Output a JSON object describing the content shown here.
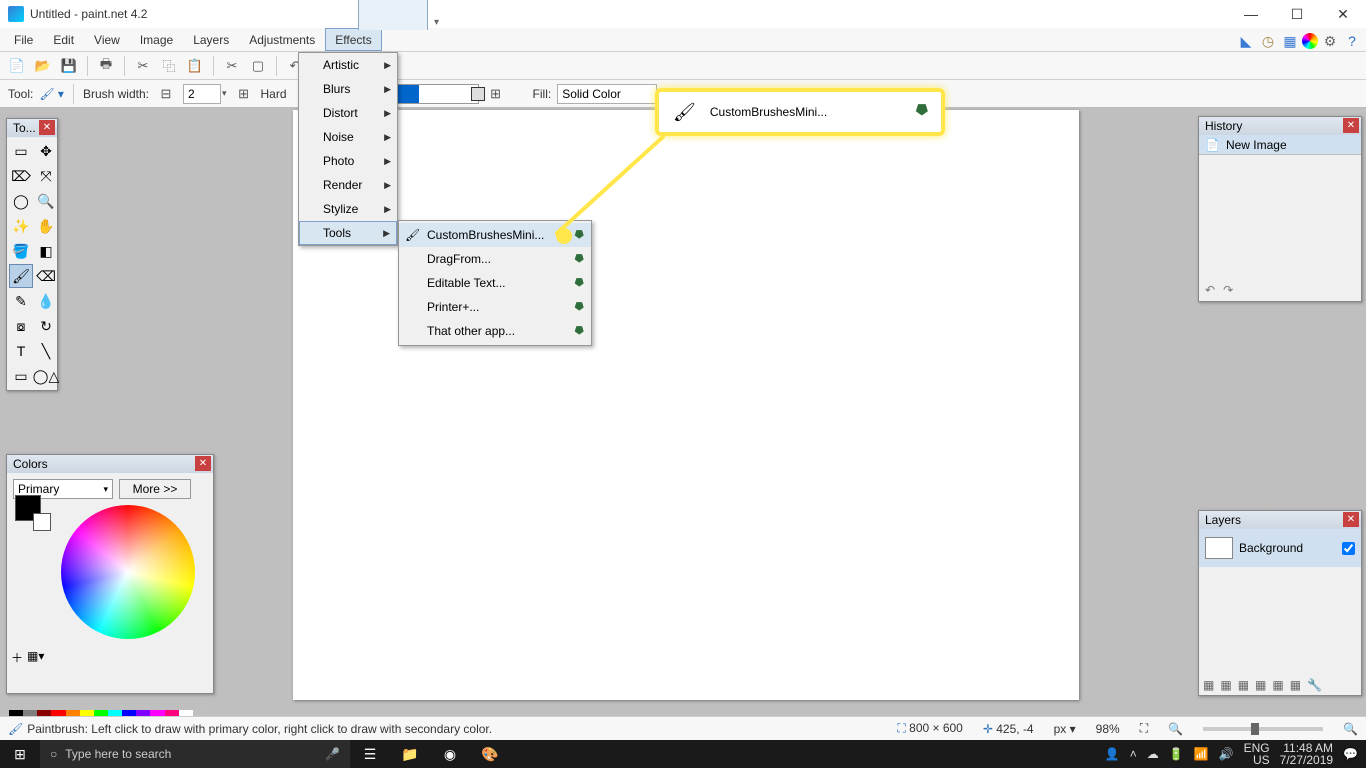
{
  "window": {
    "title": "Untitled - paint.net 4.2"
  },
  "menubar": [
    "File",
    "Edit",
    "View",
    "Image",
    "Layers",
    "Adjustments",
    "Effects"
  ],
  "toolbar2": {
    "tool_label": "Tool:",
    "brush_label": "Brush width:",
    "brush_value": "2",
    "hardness_label": "Hard",
    "fill_label": "Fill:",
    "fill_value": "Solid Color"
  },
  "effects_menu": [
    "Artistic",
    "Blurs",
    "Distort",
    "Noise",
    "Photo",
    "Render",
    "Stylize",
    "Tools"
  ],
  "tools_submenu": [
    "CustomBrushesMini...",
    "DragFrom...",
    "Editable Text...",
    "Printer+...",
    "That other app..."
  ],
  "callout": {
    "label": "CustomBrushesMini..."
  },
  "panels": {
    "tools": {
      "title": "To..."
    },
    "colors": {
      "title": "Colors",
      "primary": "Primary",
      "more": "More  >>"
    },
    "history": {
      "title": "History",
      "item": "New Image"
    },
    "layers": {
      "title": "Layers",
      "item": "Background"
    }
  },
  "statusbar": {
    "hint": "Paintbrush: Left click to draw with primary color, right click to draw with secondary color.",
    "dims": "800 × 600",
    "coords": "425, -4",
    "unit": "px",
    "zoom": "98%"
  },
  "taskbar": {
    "search_placeholder": "Type here to search",
    "lang1": "ENG",
    "lang2": "US",
    "time": "11:48 AM",
    "date": "7/27/2019"
  },
  "palette_colors": [
    "#000",
    "#7f7f7f",
    "#880000",
    "#ff0000",
    "#ff7f00",
    "#ffff00",
    "#00ff00",
    "#00ffff",
    "#0000ff",
    "#7f00ff",
    "#ff00ff",
    "#ff007f",
    "#fff",
    "#c0c0c0"
  ]
}
